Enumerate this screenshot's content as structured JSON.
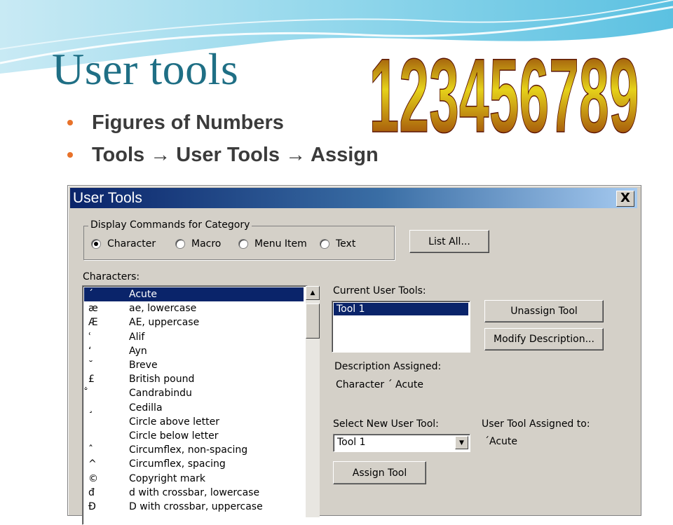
{
  "slide": {
    "title": "User tools",
    "wordart": "123456789",
    "bullets": [
      "Figures of Numbers",
      "Tools → User Tools → Assign"
    ],
    "accent_color": "#1f6f85",
    "bullet_color": "#e8722a"
  },
  "dialog": {
    "title": "User Tools",
    "close_label": "X",
    "category_group": {
      "legend": "Display Commands for Category",
      "options": [
        "Character",
        "Macro",
        "Menu Item",
        "Text"
      ],
      "selected": "Character"
    },
    "list_all_label": "List All...",
    "characters_label": "Characters:",
    "characters": [
      {
        "symbol": "´",
        "name": "Acute",
        "selected": true
      },
      {
        "symbol": "æ",
        "name": "ae, lowercase"
      },
      {
        "symbol": "Æ",
        "name": "AE, uppercase"
      },
      {
        "symbol": "ʿ",
        "name": "Alif"
      },
      {
        "symbol": "ʻ",
        "name": "Ayn"
      },
      {
        "symbol": "˘",
        "name": "Breve"
      },
      {
        "symbol": "£",
        "name": "British pound"
      },
      {
        "symbol": "̐",
        "name": "Candrabindu"
      },
      {
        "symbol": "¸",
        "name": "Cedilla"
      },
      {
        "symbol": "",
        "name": "Circle above letter"
      },
      {
        "symbol": "",
        "name": "Circle below letter"
      },
      {
        "symbol": "ˆ",
        "name": "Circumflex, non-spacing"
      },
      {
        "symbol": "^",
        "name": "Circumflex, spacing"
      },
      {
        "symbol": "©",
        "name": "Copyright mark"
      },
      {
        "symbol": "đ",
        "name": "d with crossbar, lowercase"
      },
      {
        "symbol": "Đ",
        "name": "D with crossbar, uppercase"
      }
    ],
    "current_tools_label": "Current User Tools:",
    "current_tools": [
      "Tool 1"
    ],
    "unassign_label": "Unassign Tool",
    "modify_label": "Modify Description...",
    "description_label": "Description Assigned:",
    "description_value": "Character  ´ Acute",
    "select_new_label": "Select New User Tool:",
    "select_new_value": "Tool 1",
    "assigned_to_label": "User Tool Assigned to:",
    "assigned_to_value": "´Acute",
    "assign_label": "Assign Tool"
  }
}
